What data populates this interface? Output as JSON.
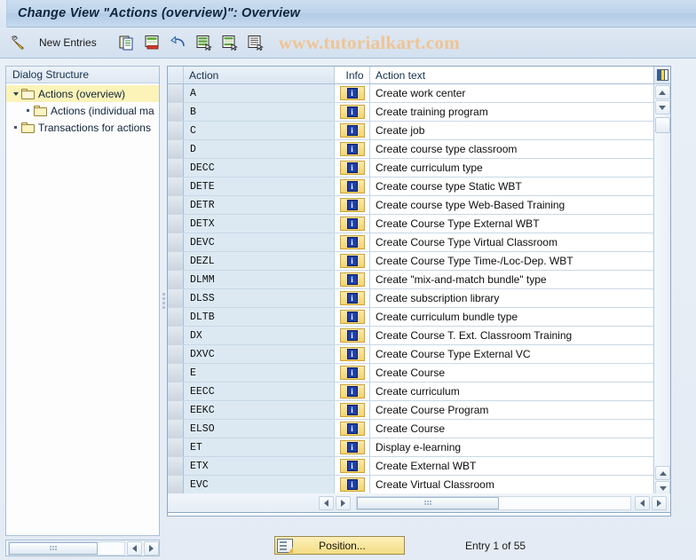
{
  "window": {
    "title": "Change View \"Actions (overview)\": Overview"
  },
  "watermark": "www.tutorialkart.com",
  "toolbar": {
    "display_change_icon": "pencil-display-change-icon",
    "new_entries_label": "New Entries",
    "buttons": [
      {
        "name": "copy-as-button",
        "icon": "copy-icon"
      },
      {
        "name": "delete-button",
        "icon": "delete-icon"
      },
      {
        "name": "undo-button",
        "icon": "undo-icon"
      },
      {
        "name": "select-all-button",
        "icon": "select-all-icon"
      },
      {
        "name": "select-block-button",
        "icon": "select-block-icon"
      },
      {
        "name": "deselect-all-button",
        "icon": "deselect-all-icon"
      }
    ]
  },
  "sidebar": {
    "header": "Dialog Structure",
    "items": [
      {
        "label": "Actions (overview)",
        "level": 0,
        "expanded": true,
        "selected": true
      },
      {
        "label": "Actions (individual ma",
        "level": 1,
        "expanded": false,
        "selected": false
      },
      {
        "label": "Transactions for actions",
        "level": 0,
        "expanded": false,
        "selected": false
      }
    ]
  },
  "table": {
    "columns": [
      "Action",
      "Info",
      "Action text"
    ],
    "rows": [
      {
        "action": "A",
        "info": "info-icon",
        "text": "Create work center"
      },
      {
        "action": "B",
        "info": "info-icon",
        "text": "Create training program"
      },
      {
        "action": "C",
        "info": "info-icon",
        "text": "Create job"
      },
      {
        "action": "D",
        "info": "info-icon",
        "text": "Create course type classroom"
      },
      {
        "action": "DECC",
        "info": "info-icon",
        "text": "Create curriculum type"
      },
      {
        "action": "DETE",
        "info": "info-icon",
        "text": "Create course type Static WBT"
      },
      {
        "action": "DETR",
        "info": "info-icon",
        "text": "Create course type Web-Based Training"
      },
      {
        "action": "DETX",
        "info": "info-icon",
        "text": "Create Course Type External WBT"
      },
      {
        "action": "DEVC",
        "info": "info-icon",
        "text": "Create Course Type Virtual Classroom"
      },
      {
        "action": "DEZL",
        "info": "info-icon",
        "text": "Create Course Type Time-/Loc-Dep. WBT"
      },
      {
        "action": "DLMM",
        "info": "info-icon",
        "text": "Create \"mix-and-match bundle\" type"
      },
      {
        "action": "DLSS",
        "info": "info-icon",
        "text": "Create subscription library"
      },
      {
        "action": "DLTB",
        "info": "info-icon",
        "text": "Create curriculum bundle type"
      },
      {
        "action": "DX",
        "info": "info-icon",
        "text": "Create Course T. Ext. Classroom Training"
      },
      {
        "action": "DXVC",
        "info": "info-icon",
        "text": "Create Course Type External VC"
      },
      {
        "action": "E",
        "info": "info-icon",
        "text": "Create Course"
      },
      {
        "action": "EECC",
        "info": "info-icon",
        "text": "Create curriculum"
      },
      {
        "action": "EEKC",
        "info": "info-icon",
        "text": "Create Course Program"
      },
      {
        "action": "ELSO",
        "info": "info-icon",
        "text": "Create Course"
      },
      {
        "action": "ET",
        "info": "info-icon",
        "text": "Display e-learning"
      },
      {
        "action": "ETX",
        "info": "info-icon",
        "text": "Create External WBT"
      },
      {
        "action": "EVC",
        "info": "info-icon",
        "text": "Create Virtual Classroom"
      }
    ]
  },
  "footer": {
    "position_label": "Position...",
    "entry_status": "Entry 1 of 55"
  },
  "colors": {
    "title_bar": "#bcd3ea",
    "selected_row": "#fcf3b8",
    "key_column": "#dce9f3",
    "info_button": "#f2d470",
    "info_square": "#1d3fa8",
    "watermark": "#f0c492"
  }
}
